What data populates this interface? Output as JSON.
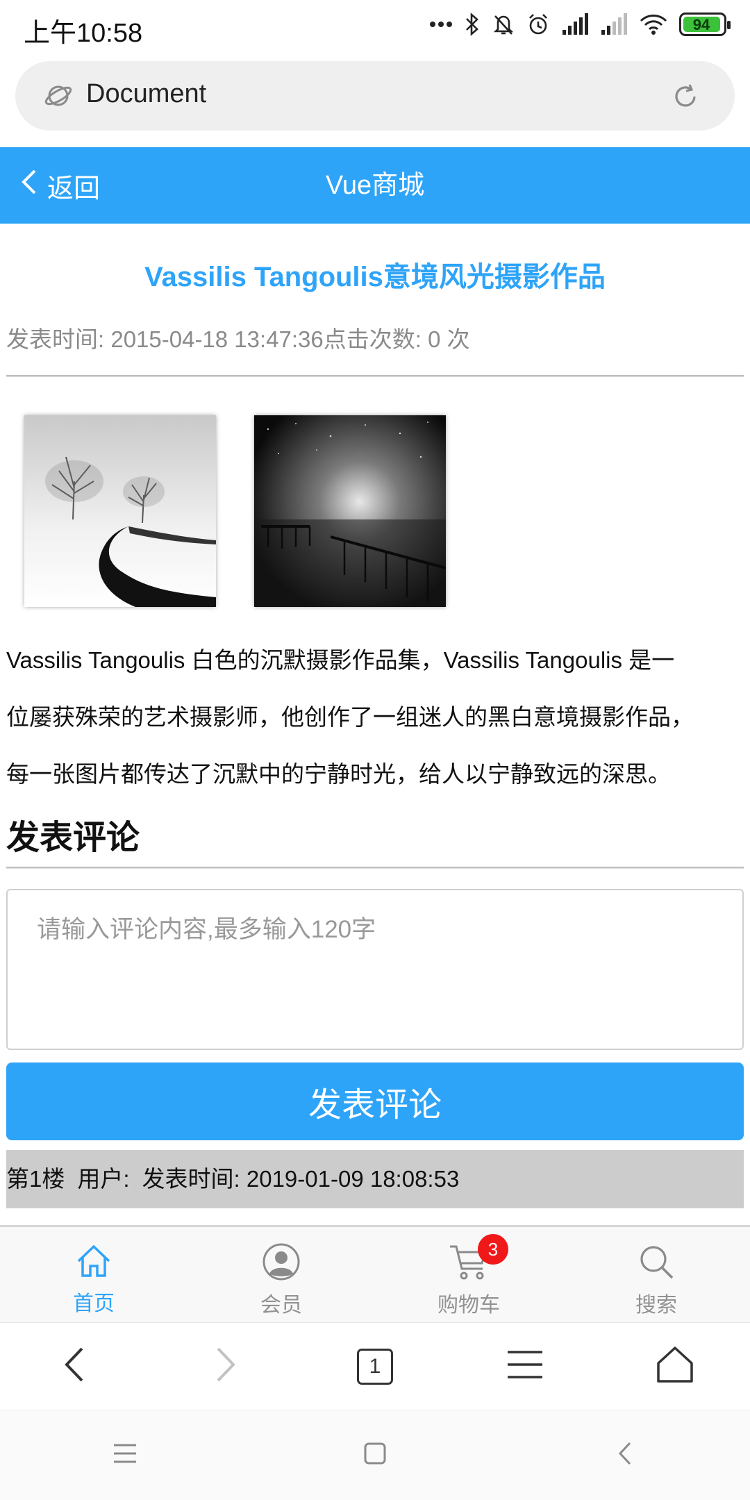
{
  "status_bar": {
    "time": "上午10:58",
    "battery": "94",
    "icons": [
      "more-dots-icon",
      "bluetooth-icon",
      "mute-bell-icon",
      "alarm-icon",
      "signal-icon",
      "signal-icon-2",
      "wifi-icon",
      "battery-icon"
    ]
  },
  "browser": {
    "address_text": "Document",
    "tab_count": "1"
  },
  "header": {
    "back_label": "返回",
    "title": "Vue商城"
  },
  "article": {
    "title": "Vassilis Tangoulis意境风光摄影作品",
    "meta": "发表时间: 2015-04-18 13:47:36点击次数: 0 次",
    "body_lines": [
      "Vassilis Tangoulis 白色的沉默摄影作品集，Vassilis Tangoulis 是一",
      "位屡获殊荣的艺术摄影师，他创作了一组迷人的黑白意境摄影作品，",
      "每一张图片都传达了沉默中的宁静时光，给人以宁静致远的深思。"
    ]
  },
  "comments": {
    "heading": "发表评论",
    "input_placeholder": "请输入评论内容,最多输入120字",
    "submit_label": "发表评论",
    "items": [
      {
        "floor": "第1楼",
        "user": "用户:",
        "time": "发表时间: 2019-01-09 18:08:53"
      }
    ]
  },
  "tabbar": {
    "items": [
      {
        "label": "首页",
        "icon": "home-icon",
        "active": true
      },
      {
        "label": "会员",
        "icon": "member-icon",
        "active": false
      },
      {
        "label": "购物车",
        "icon": "cart-icon",
        "active": false,
        "badge": "3"
      },
      {
        "label": "搜索",
        "icon": "search-icon",
        "active": false
      }
    ]
  },
  "colors": {
    "accent": "#2ea4f9",
    "badge": "#f01818",
    "comment_row_bg": "#cccccc"
  }
}
